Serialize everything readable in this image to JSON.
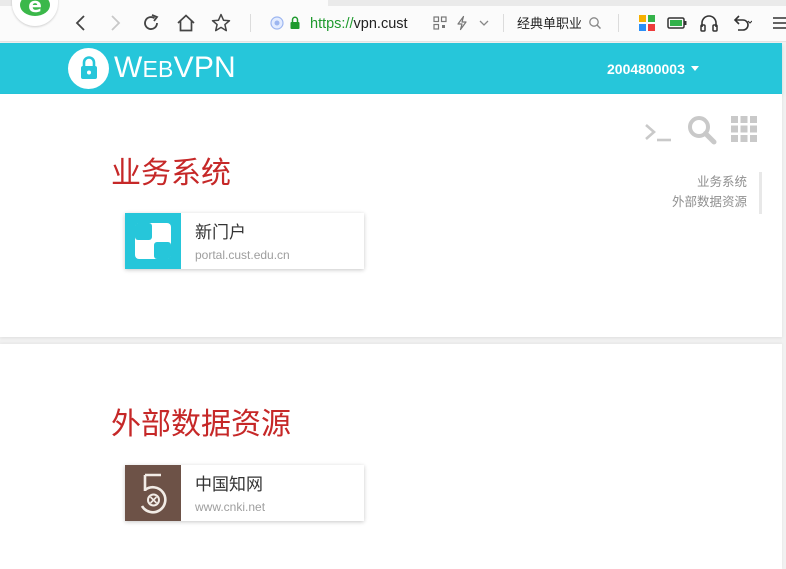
{
  "browser": {
    "url_protocol": "https://",
    "url_host": "vpn.cust",
    "search_text": "经典单职业"
  },
  "header": {
    "brand_big": "W",
    "brand_small": "EB",
    "brand_rest": "VPN",
    "username": "2004800003",
    "colors": {
      "primary": "#26c6da",
      "title": "#c62828"
    }
  },
  "toolbar": {
    "icons": [
      "terminal-icon",
      "search-icon",
      "grid-icon"
    ]
  },
  "toc": {
    "items": [
      "业务系统",
      "外部数据资源"
    ]
  },
  "sections": [
    {
      "title": "业务系统",
      "cards": [
        {
          "name": "新门户",
          "host": "portal.cust.edu.cn",
          "icon": "portal-logo-icon"
        }
      ]
    },
    {
      "title": "外部数据资源",
      "cards": [
        {
          "name": "中国知网",
          "host": "www.cnki.net",
          "icon": "cnki-logo-icon"
        }
      ]
    }
  ]
}
